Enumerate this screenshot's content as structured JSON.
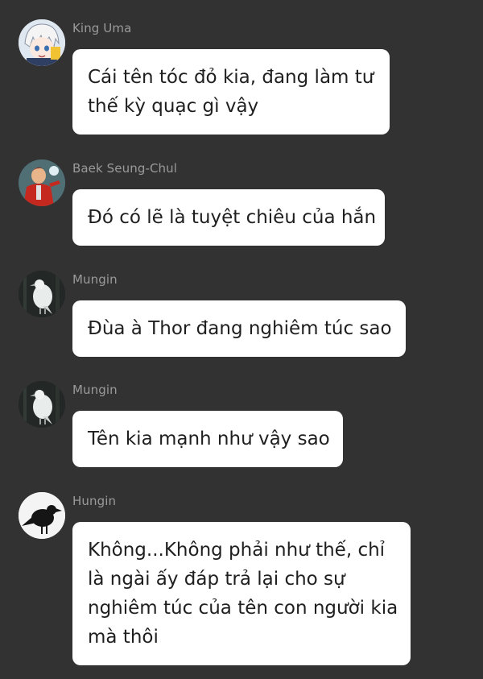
{
  "messages": [
    {
      "sender": "King Uma",
      "avatar_icon": "anime-character-avatar-icon",
      "lines": [
        "Cái tên tóc đỏ kia, đang làm tư",
        "thế kỳ quạc gì vậy"
      ]
    },
    {
      "sender": "Baek Seung-Chul",
      "avatar_icon": "red-jacket-character-avatar-icon",
      "lines": [
        "Đó có lẽ là tuyệt chiêu của hắn"
      ]
    },
    {
      "sender": "Mungin",
      "avatar_icon": "white-raven-avatar-icon",
      "lines": [
        "Đùa à Thor đang nghiêm túc sao"
      ]
    },
    {
      "sender": "Mungin",
      "avatar_icon": "white-raven-avatar-icon",
      "lines": [
        "Tên kia mạnh như vậy sao"
      ]
    },
    {
      "sender": "Hungin",
      "avatar_icon": "black-raven-avatar-icon",
      "lines": [
        "Không...Không phải như thế, chỉ",
        "là ngài ấy đáp trả lại cho sự",
        "nghiêm túc của tên con người kia",
        "mà thôi"
      ]
    }
  ],
  "colors": {
    "background": "#323232",
    "bubble": "#ffffff",
    "sender_name": "#9a9a9a",
    "message_text": "#1f1f1f"
  }
}
